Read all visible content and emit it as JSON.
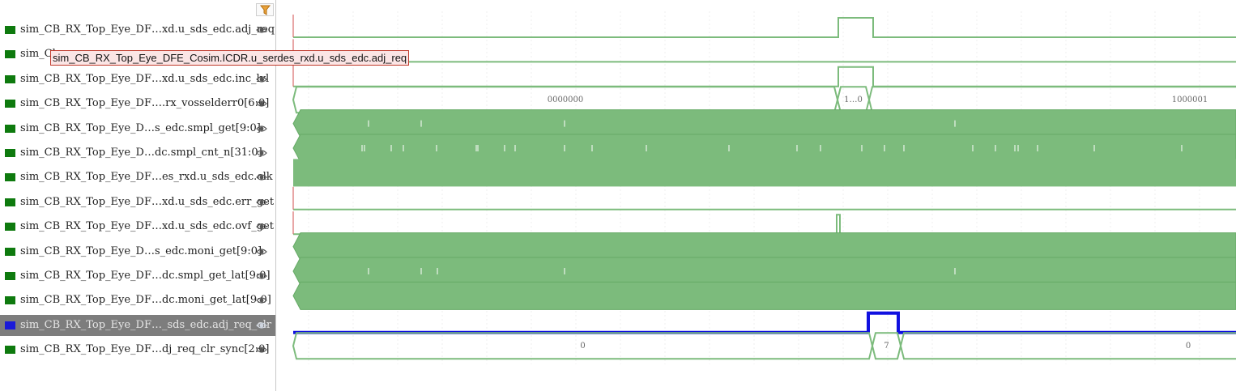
{
  "toolbar": {
    "filter_icon": "filter-icon"
  },
  "tooltip": {
    "text": "sim_CB_RX_Top_Eye_DFE_Cosim.ICDR.u_serdes_rxd.u_sds_edc.adj_req"
  },
  "signals": [
    {
      "name": "sim_CB_RX_Top_Eye_DF…xd.u_sds_edc.adj_req",
      "color": "#0e7a0e",
      "selected": false
    },
    {
      "name": "sim_Cl",
      "color": "#0e7a0e",
      "selected": false
    },
    {
      "name": "sim_CB_RX_Top_Eye_DF…xd.u_sds_edc.inc_lvl",
      "color": "#0e7a0e",
      "selected": false
    },
    {
      "name": "sim_CB_RX_Top_Eye_DF….rx_vosselderr0[6:0]",
      "color": "#0e7a0e",
      "selected": false
    },
    {
      "name": "sim_CB_RX_Top_Eye_D…s_edc.smpl_get[9:0]",
      "color": "#0e7a0e",
      "selected": false
    },
    {
      "name": "sim_CB_RX_Top_Eye_D…dc.smpl_cnt_n[31:0]",
      "color": "#0e7a0e",
      "selected": false
    },
    {
      "name": "sim_CB_RX_Top_Eye_DF…es_rxd.u_sds_edc.clk",
      "color": "#0e7a0e",
      "selected": false
    },
    {
      "name": "sim_CB_RX_Top_Eye_DF…xd.u_sds_edc.err_get",
      "color": "#0e7a0e",
      "selected": false
    },
    {
      "name": "sim_CB_RX_Top_Eye_DF…xd.u_sds_edc.ovf_get",
      "color": "#0e7a0e",
      "selected": false
    },
    {
      "name": "sim_CB_RX_Top_Eye_D…s_edc.moni_get[9:0]",
      "color": "#0e7a0e",
      "selected": false
    },
    {
      "name": "sim_CB_RX_Top_Eye_DF…dc.smpl_get_lat[9:0]",
      "color": "#0e7a0e",
      "selected": false
    },
    {
      "name": "sim_CB_RX_Top_Eye_DF…dc.moni_get_lat[9:0]",
      "color": "#0e7a0e",
      "selected": false
    },
    {
      "name": "sim_CB_RX_Top_Eye_DF…_sds_edc.adj_req_clr",
      "color": "#1a1ad8",
      "selected": true
    },
    {
      "name": "sim_CB_RX_Top_Eye_DF…dj_req_clr_sync[2:0]",
      "color": "#0e7a0e",
      "selected": false
    }
  ],
  "bus_values": {
    "vosselderr_left": "0000000",
    "vosselderr_mid": "1…0",
    "vosselderr_right": "1000001",
    "sync_left": "0",
    "sync_mid": "7",
    "sync_right": "0"
  },
  "colors": {
    "wave": "#7cbb7c",
    "wave_dark": "#66aa66",
    "selected_wave": "#1010e0",
    "marker": "#d96b6b"
  },
  "icons": {
    "eye": "eye-icon"
  }
}
